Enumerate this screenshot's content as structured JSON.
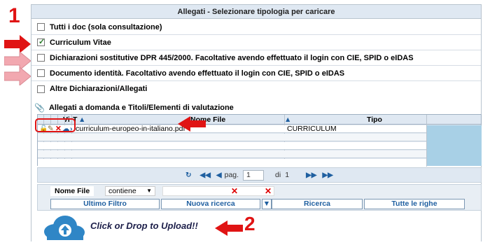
{
  "header": {
    "title": "Allegati - Selezionare tipologia per caricare"
  },
  "options": [
    {
      "label": "Tutti i doc (sola consultazione)",
      "checked": false
    },
    {
      "label": "Curriculum Vitae",
      "checked": true
    },
    {
      "label": "Dichiarazioni sostitutive DPR 445/2000. Facoltative avendo effettuato il login con CIE, SPID o eIDAS",
      "checked": false
    },
    {
      "label": "Documento identità. Facoltativo avendo effettuato il login con CIE, SPID o eIDAS",
      "checked": false
    },
    {
      "label": "Altre Dichiarazioni/Allegati",
      "checked": false
    }
  ],
  "section": {
    "title": "Allegati a domanda e Titoli/Elementi di valutazione"
  },
  "grid": {
    "headers": {
      "vi": "Vi",
      "t": "T",
      "name": "Nome File",
      "type": "Tipo"
    },
    "rows": [
      {
        "name": "curriculum-europeo-in-italiano.pdf",
        "type": "CURRICULUM"
      }
    ]
  },
  "pager": {
    "page_label": "pag.",
    "page": "1",
    "of_label": "di",
    "total": "1"
  },
  "filter": {
    "field_label": "Nome File",
    "operator": "contiene",
    "buttons": {
      "last": "Ultimo Filtro",
      "new": "Nuova ricerca",
      "search": "Ricerca",
      "all": "Tutte le righe"
    }
  },
  "upload": {
    "text": "Click or Drop to Upload!!"
  },
  "annotations": {
    "one": "1",
    "two": "2"
  },
  "colors": {
    "accent": "#1f5fa0",
    "annotation": "#e01414",
    "header_bg": "#dfe8f2"
  }
}
